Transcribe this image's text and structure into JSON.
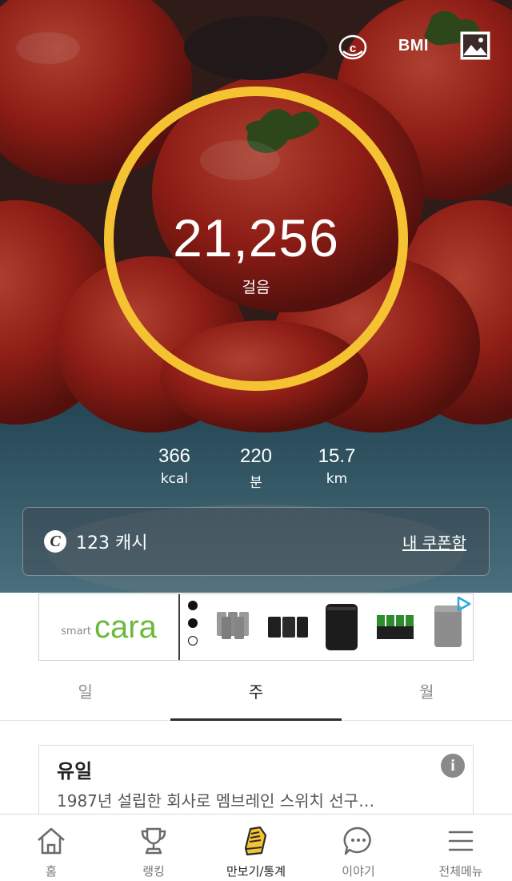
{
  "header": {
    "coin_icon": "coin-icon",
    "bmi_label": "BMI",
    "photo_icon": "image-icon"
  },
  "pedometer": {
    "steps": "21,256",
    "steps_unit": "걸음",
    "ring_color": "#F5C332"
  },
  "stats": [
    {
      "value": "366",
      "unit": "kcal"
    },
    {
      "value": "220",
      "unit": "분"
    },
    {
      "value": "15.7",
      "unit": "km"
    }
  ],
  "cash": {
    "icon_letter": "C",
    "text": "123 캐시",
    "coupon_link": "내 쿠폰함"
  },
  "ad": {
    "brand_small": "smart",
    "brand_big": "cara"
  },
  "tabs": [
    {
      "label": "일",
      "active": false
    },
    {
      "label": "주",
      "active": true
    },
    {
      "label": "월",
      "active": false
    }
  ],
  "card": {
    "title": "유일",
    "description": "1987년 설립한 회사로 멤브레인 스위치 선구…",
    "info_icon": "i"
  },
  "bottom_nav": [
    {
      "label": "홈",
      "icon": "home-icon"
    },
    {
      "label": "랭킹",
      "icon": "trophy-icon"
    },
    {
      "label": "만보기/통계",
      "icon": "shoe-icon",
      "active": true
    },
    {
      "label": "이야기",
      "icon": "chat-icon"
    },
    {
      "label": "전체메뉴",
      "icon": "menu-icon"
    }
  ]
}
